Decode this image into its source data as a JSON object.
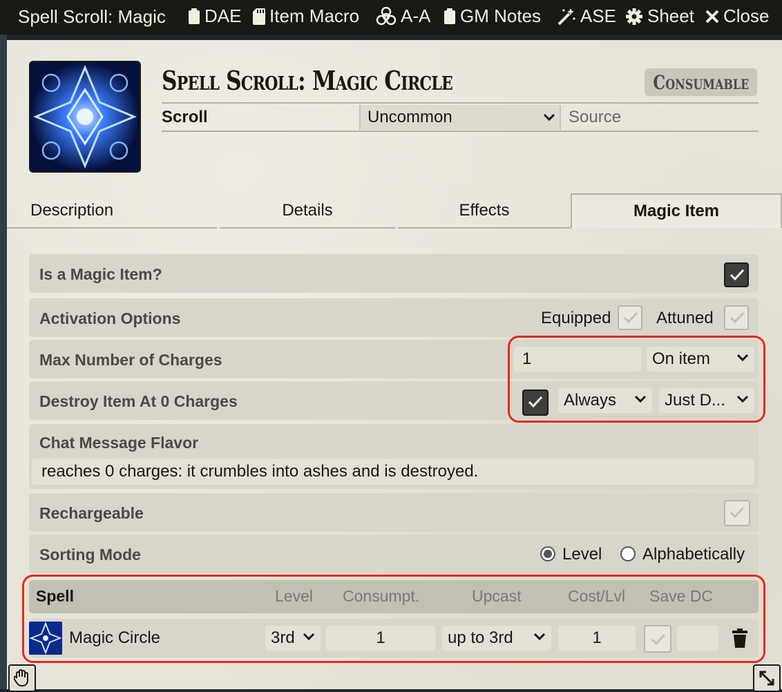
{
  "header": {
    "title": "Spell Scroll: Magic",
    "buttons": [
      {
        "label": "DAE",
        "icon": "clipboard-icon"
      },
      {
        "label": "Item Macro",
        "icon": "sd-card-icon"
      },
      {
        "label": "A-A",
        "icon": "biohazard-icon"
      },
      {
        "label": "GM Notes",
        "icon": "clipboard-icon"
      },
      {
        "label": "ASE",
        "icon": "magic-wand-icon"
      },
      {
        "label": "Sheet",
        "icon": "gear-icon"
      },
      {
        "label": "Close",
        "icon": "close-icon"
      }
    ]
  },
  "item": {
    "name": "Spell Scroll: Magic Circle",
    "type_badge": "Consumable",
    "subtype": "Scroll",
    "rarity": "Uncommon",
    "source_placeholder": "Source"
  },
  "tabs": [
    "Description",
    "Details",
    "Effects",
    "Magic Item"
  ],
  "active_tab": "Magic Item",
  "magic_item": {
    "is_magic_label": "Is a Magic Item?",
    "is_magic": true,
    "activation_label": "Activation Options",
    "equipped_label": "Equipped",
    "attuned_label": "Attuned",
    "max_charges_label": "Max Number of Charges",
    "max_charges": "1",
    "charge_type": "On item",
    "destroy_label": "Destroy Item At 0 Charges",
    "destroy": true,
    "destroy_check": "Always",
    "destroy_type": "Just D...",
    "flavor_label": "Chat Message Flavor",
    "flavor_text": "reaches 0 charges: it crumbles into ashes and is destroyed.",
    "rechargeable_label": "Rechargeable",
    "sorting_label": "Sorting Mode",
    "sort_level": "Level",
    "sort_alpha": "Alphabetically",
    "sorting_mode": "Level"
  },
  "spells_table": {
    "headers": [
      "Spell",
      "Level",
      "Consumpt.",
      "Upcast",
      "Cost/Lvl",
      "Save DC"
    ],
    "rows": [
      {
        "name": "Magic Circle",
        "level": "3rd",
        "consumption": "1",
        "upcast": "up to 3rd",
        "cost": "1",
        "save_dc": ""
      }
    ]
  }
}
